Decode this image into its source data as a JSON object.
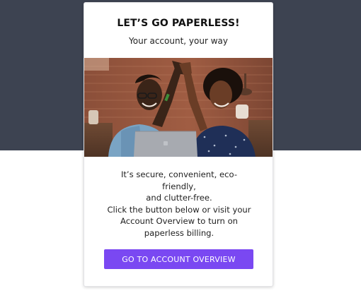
{
  "card": {
    "headline": "LET’S GO PAPERLESS!",
    "subhead": "Your account, your way",
    "body_lines": [
      "It’s secure, convenient, eco-",
      "friendly,",
      "and clutter-free.",
      "Click the button below or visit your",
      "Account Overview to turn on",
      "paperless billing."
    ],
    "cta_label": "GO TO ACCOUNT OVERVIEW"
  },
  "colors": {
    "top_band": "#3d4351",
    "accent": "#7a48f2",
    "card_background": "#ffffff"
  },
  "image": {
    "semantic": "two-people-high-five-photo"
  }
}
